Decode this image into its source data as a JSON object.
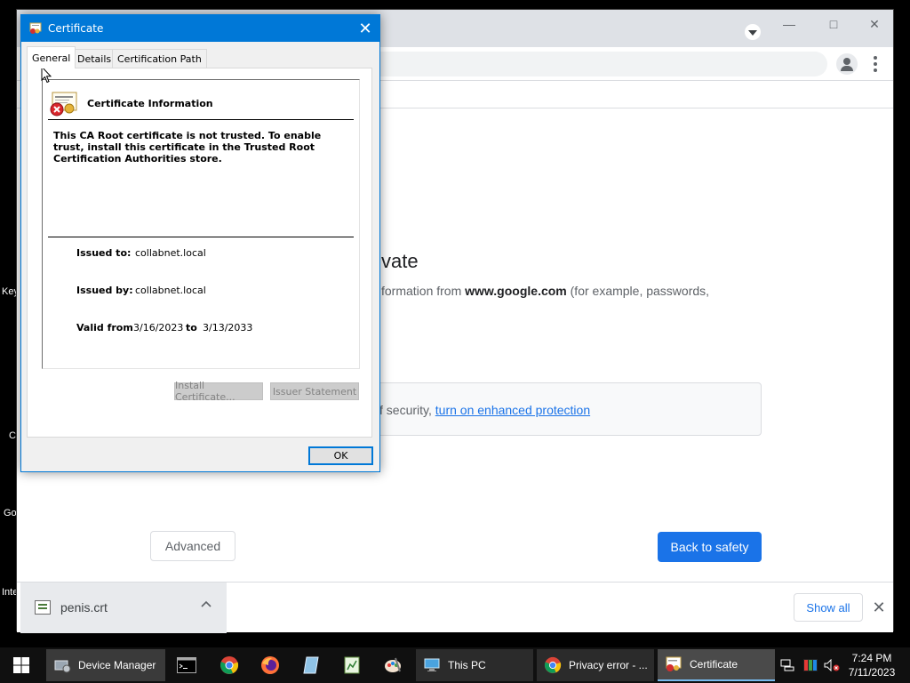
{
  "desktop": {
    "labels": [
      "Key",
      "C",
      "Go",
      "Inte"
    ]
  },
  "chrome": {
    "heading_partial": "vate",
    "desc_prefix": "formation from ",
    "desc_domain": "www.google.com",
    "desc_suffix": " (for example, passwords,",
    "security_prefix": "f security, ",
    "security_link": "turn on enhanced protection",
    "advanced_label": "Advanced",
    "back_label": "Back to safety",
    "window_controls": [
      "minimize-icon",
      "maximize-icon",
      "close-icon"
    ]
  },
  "download_shelf": {
    "file_name": "penis.crt",
    "show_all_label": "Show all",
    "close_glyph": "✕"
  },
  "certificate_dialog": {
    "title": "Certificate",
    "close_glyph": "✕",
    "tabs": [
      "General",
      "Details",
      "Certification Path"
    ],
    "active_tab": "General",
    "info_title": "Certificate Information",
    "warning": "This CA Root certificate is not trusted. To enable trust, install this certificate in the Trusted Root Certification Authorities store.",
    "issued_to_label": "Issued to:",
    "issued_to_value": "collabnet.local",
    "issued_by_label": "Issued by:",
    "issued_by_value": "collabnet.local",
    "valid_from_label": "Valid from",
    "valid_from_value": "3/16/2023",
    "valid_to_label": "to",
    "valid_to_value": "3/13/2033",
    "install_button": "Install Certificate...",
    "issuer_button": "Issuer Statement",
    "ok_button": "OK"
  },
  "taskbar": {
    "device_manager": "Device Manager",
    "this_pc": "This PC",
    "privacy_error": "Privacy error - ...",
    "certificate": "Certificate",
    "time": "7:24 PM",
    "date": "7/11/2023"
  }
}
